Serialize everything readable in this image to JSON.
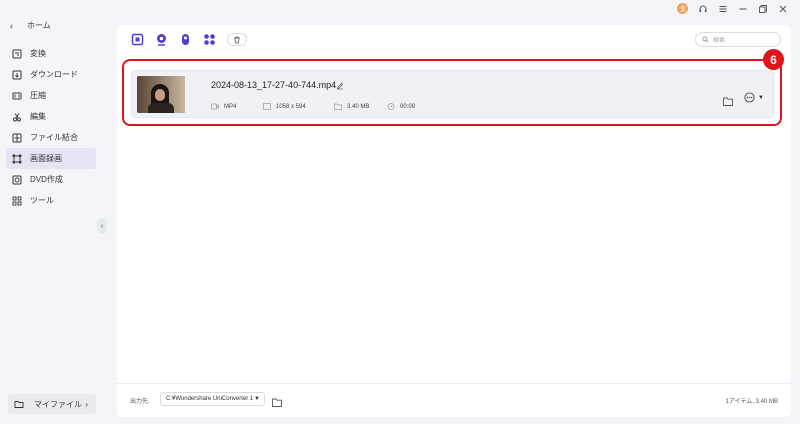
{
  "sidebar": {
    "home_label": "ホーム",
    "items": [
      {
        "label": "変換",
        "icon": "convert-icon"
      },
      {
        "label": "ダウンロード",
        "icon": "download-icon"
      },
      {
        "label": "圧縮",
        "icon": "compress-icon"
      },
      {
        "label": "編集",
        "icon": "scissors-icon"
      },
      {
        "label": "ファイル結合",
        "icon": "merge-icon"
      },
      {
        "label": "画面録画",
        "icon": "screen-record-icon",
        "active": true
      },
      {
        "label": "DVD作成",
        "icon": "dvd-icon"
      },
      {
        "label": "ツール",
        "icon": "tools-grid-icon"
      }
    ],
    "myfile_label": "マイファイル"
  },
  "search": {
    "placeholder": "検索"
  },
  "file": {
    "name": "2024-08-13_17-27-40-744.mp4",
    "format": "MP4",
    "resolution": "1058 x 594",
    "size": "3.40 MB",
    "duration": "00:09"
  },
  "annotation": {
    "badge": "6",
    "color": "#e0141b"
  },
  "footer": {
    "output_label": "出力先:",
    "output_path": "C:¥Wondershare UniConverter 1",
    "summary": "1アイテム, 3.40 MB"
  },
  "colors": {
    "accent": "#5b4fd8",
    "active_bg": "#e4e4f4"
  }
}
